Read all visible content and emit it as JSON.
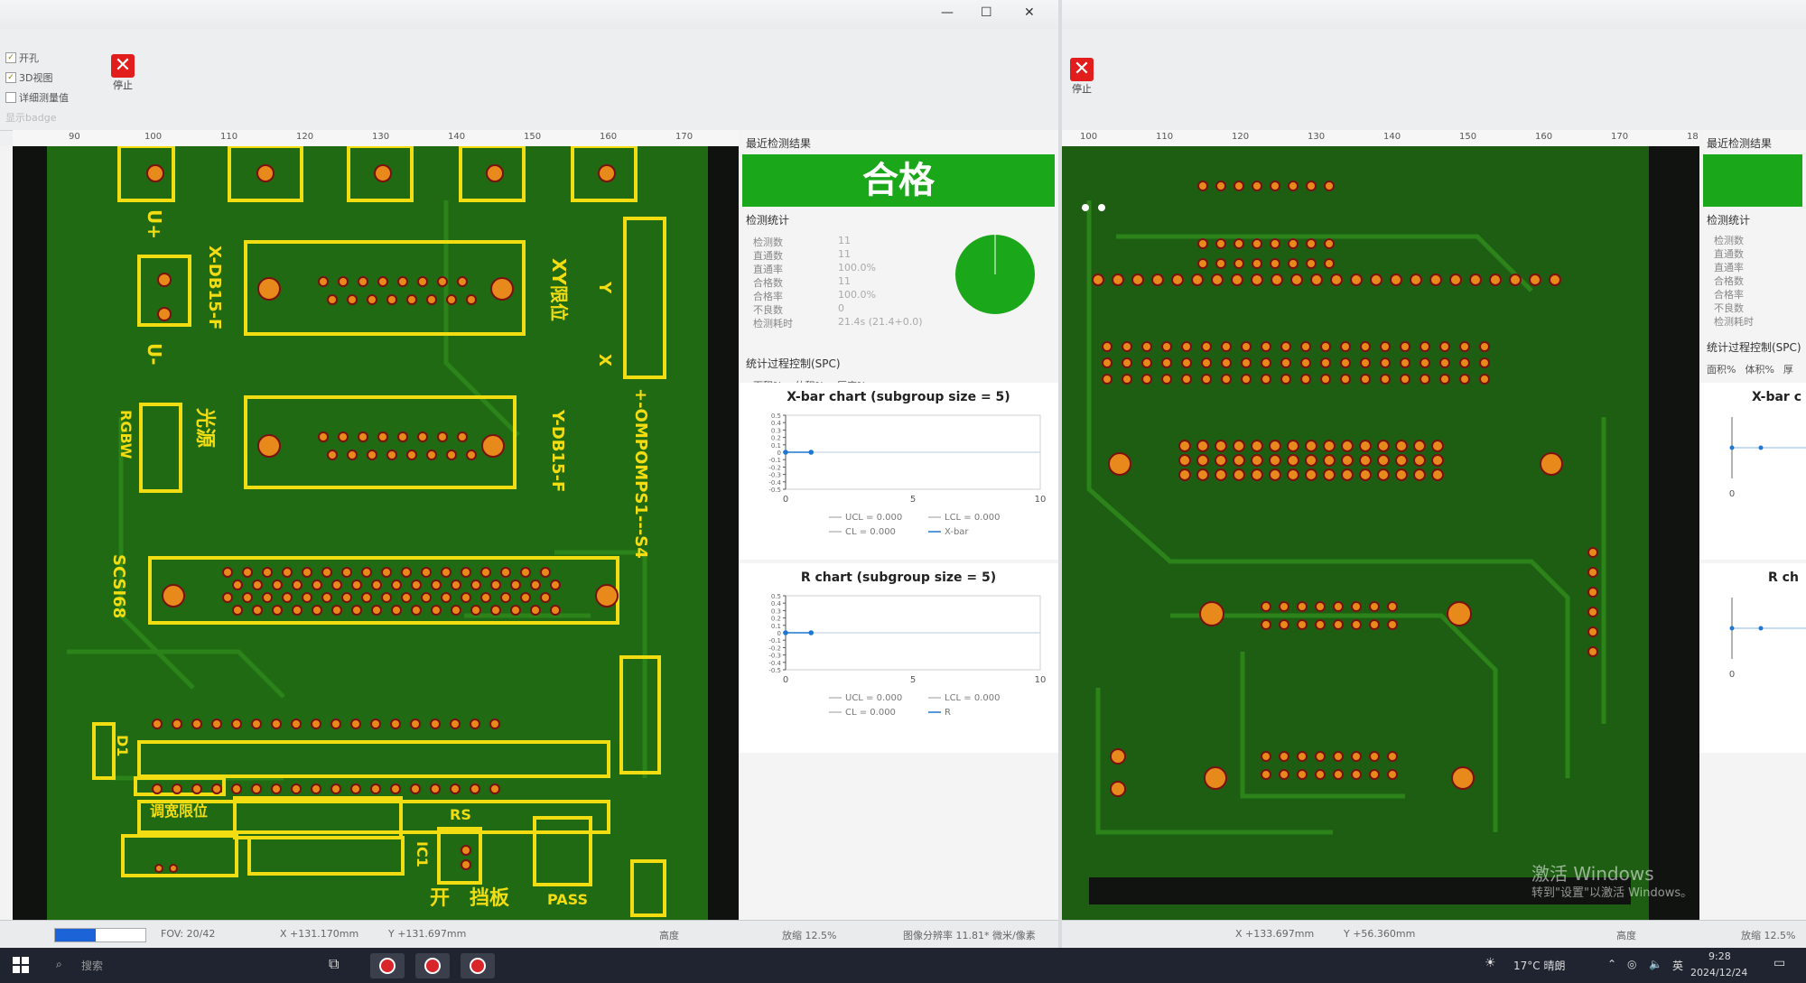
{
  "left_window": {
    "controls": {
      "minimize": "—",
      "maximize": "☐",
      "close": "✕"
    },
    "toolbar": {
      "checkboxes": [
        {
          "label": "开孔",
          "checked": true
        },
        {
          "label": "3D视图",
          "checked": true
        },
        {
          "label": "详细测量值",
          "checked": false
        },
        {
          "label": "显示badge",
          "checked": false
        }
      ],
      "stop_label": "停止"
    },
    "ruler_ticks": [
      "90",
      "100",
      "110",
      "120",
      "130",
      "140",
      "150",
      "160",
      "170"
    ],
    "board_labels": [
      "U+",
      "U-",
      "X-DB15-F",
      "XY限位",
      "Y",
      "X",
      "RGBW",
      "光源",
      "Y-DB15-F",
      "SCSI68",
      "+-OMPOMPS1---S4",
      "D1",
      "调宽限位",
      "RS",
      "IC1",
      "开",
      "挡板",
      "PASS"
    ],
    "panel": {
      "recent_title": "最近检测结果",
      "result": "合格",
      "stats_title": "检测统计",
      "stats": [
        {
          "label": "检测数",
          "value": "11"
        },
        {
          "label": "直通数",
          "value": "11"
        },
        {
          "label": "直通率",
          "value": "100.0%"
        },
        {
          "label": "合格数",
          "value": "11"
        },
        {
          "label": "合格率",
          "value": "100.0%"
        },
        {
          "label": "不良数",
          "value": "0"
        },
        {
          "label": "检测耗时",
          "value": "21.4s (21.4+0.0)"
        }
      ],
      "spc_title": "统计过程控制(SPC)",
      "spc_tabs": [
        "面积%",
        "体积%",
        "厚度%"
      ]
    },
    "status": {
      "fov": "FOV: 20/42",
      "x": "X +131.170mm",
      "y": "Y +131.697mm",
      "height": "高度",
      "zoom": "放缩 12.5%",
      "resolution": "图像分辨率 11.81* 微米/像素"
    }
  },
  "right_window": {
    "toolbar": {
      "stop_label": "停止"
    },
    "ruler_ticks": [
      "100",
      "110",
      "120",
      "130",
      "140",
      "150",
      "160",
      "170",
      "18"
    ],
    "panel": {
      "recent_title": "最近检测结果",
      "stats_title": "检测统计",
      "stats_labels": [
        "检测数",
        "直通数",
        "直通率",
        "合格数",
        "合格率",
        "不良数",
        "检测耗时"
      ],
      "spc_title": "统计过程控制(SPC)",
      "spc_tabs": [
        "面积%",
        "体积%",
        "厚"
      ],
      "chart1_title": "X-bar c",
      "chart2_title": "R ch",
      "axis_zero": "0"
    },
    "status": {
      "x": "X +133.697mm",
      "y": "Y +56.360mm",
      "height": "高度",
      "zoom": "放缩 12.5%"
    },
    "watermark": {
      "line1": "激活 Windows",
      "line2": "转到\"设置\"以激活 Windows。"
    }
  },
  "chart_data": [
    {
      "type": "line",
      "title": "X-bar chart (subgroup size = 5)",
      "x": [
        0,
        1
      ],
      "series": [
        {
          "name": "X-bar",
          "values": [
            0.0,
            0.0
          ]
        }
      ],
      "ucl": 0.0,
      "lcl": 0.0,
      "cl": 0.0,
      "xlim": [
        0,
        10
      ],
      "ylim": [
        -0.5,
        0.5
      ],
      "xticks": [
        "0",
        "5",
        "10"
      ],
      "yticks": [
        "0.5",
        "0.4",
        "0.3",
        "0.2",
        "0.1",
        "0",
        "-0.1",
        "-0.2",
        "-0.3",
        "-0.4",
        "-0.5"
      ],
      "legend": [
        "UCL = 0.000",
        "LCL = 0.000",
        "CL = 0.000",
        "X-bar"
      ]
    },
    {
      "type": "line",
      "title": "R chart (subgroup size = 5)",
      "x": [
        0,
        1
      ],
      "series": [
        {
          "name": "R",
          "values": [
            0.0,
            0.0
          ]
        }
      ],
      "ucl": 0.0,
      "lcl": 0.0,
      "cl": 0.0,
      "xlim": [
        0,
        10
      ],
      "ylim": [
        -0.5,
        0.5
      ],
      "xticks": [
        "0",
        "5",
        "10"
      ],
      "yticks": [
        "0.5",
        "0.4",
        "0.3",
        "0.2",
        "0.1",
        "0",
        "-0.1",
        "-0.2",
        "-0.3",
        "-0.4",
        "-0.5"
      ],
      "legend": [
        "UCL = 0.000",
        "LCL = 0.000",
        "CL = 0.000",
        "R"
      ]
    },
    {
      "type": "pie",
      "values": [
        100.0,
        0.0
      ],
      "categories": [
        "合格",
        "不良"
      ]
    }
  ],
  "taskbar": {
    "search": "搜索",
    "weather": "17°C 晴朗",
    "ime": "英",
    "time": "9:28",
    "date": "2024/12/24"
  },
  "colors": {
    "pass_green": "#1aa81a",
    "pcb_green": "#1f6a12",
    "silk_yellow": "#f2dc12",
    "pad_orange": "#e8891c",
    "stop_red": "#e21d1d"
  }
}
